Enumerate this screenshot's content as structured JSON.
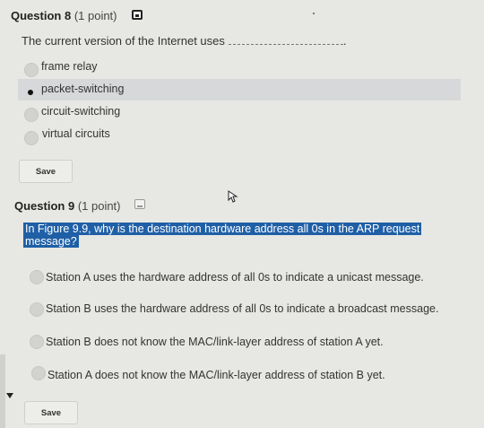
{
  "q8": {
    "title": "Question 8",
    "points": "(1 point)",
    "prompt": "The current version of the Internet uses",
    "prompt_end": ".",
    "options": [
      "frame relay",
      "packet-switching",
      "circuit-switching",
      "virtual circuits"
    ],
    "selected_option": "packet-switching",
    "save_label": "Save"
  },
  "q9": {
    "title": "Question 9",
    "points": "(1 point)",
    "prompt_line1": "In Figure 9.9, why is the destination hardware address all 0s in the ARP request",
    "prompt_line2": "message?",
    "options": [
      "Station A uses the hardware address of all 0s to indicate a unicast message.",
      "Station B uses the hardware address of all 0s to indicate a broadcast message.",
      "Station B does not know the MAC/link-layer address of station A yet.",
      "Station A does not know the MAC/link-layer address of station B yet."
    ],
    "save_label": "Save"
  },
  "icons": {
    "q8_save": "floppy-disk-icon",
    "q9_save": "floppy-disk-icon",
    "cursor": "mouse-pointer-icon",
    "left_arrow": "caret-down-icon"
  }
}
